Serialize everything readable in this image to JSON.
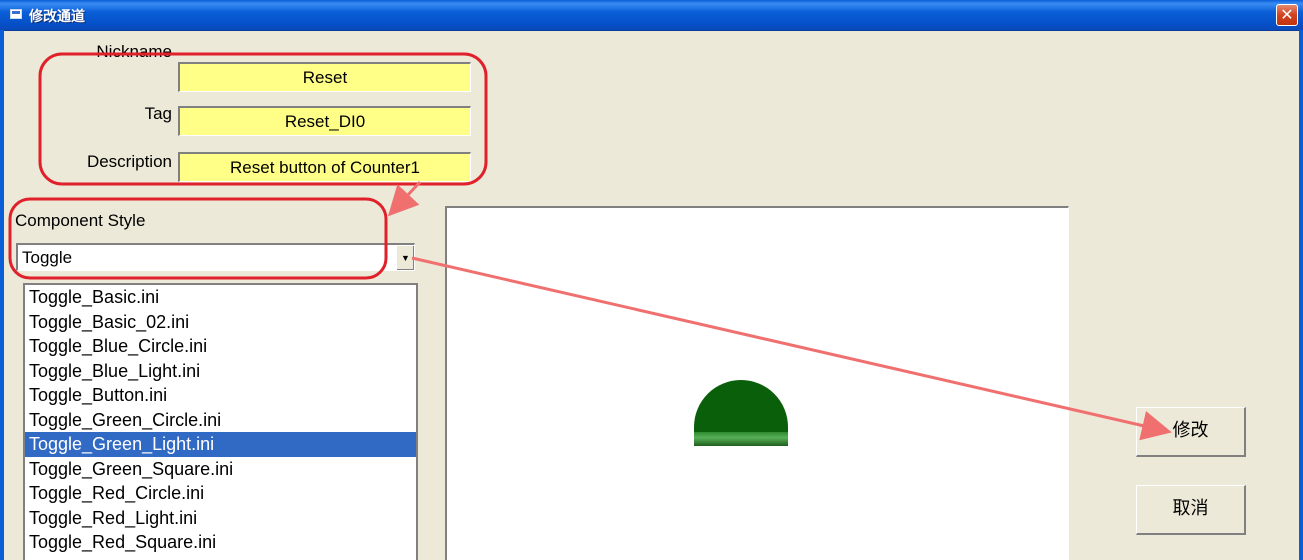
{
  "window": {
    "title": "修改通道",
    "close_icon": "close-icon"
  },
  "form": {
    "nickname_label": "Nickname",
    "nickname_value": "Reset",
    "tag_label": "Tag",
    "tag_value": "Reset_DI0",
    "description_label": "Description",
    "description_value": "Reset button of Counter1"
  },
  "component_style": {
    "label": "Component Style",
    "selected": "Toggle",
    "items": [
      "Toggle_Basic.ini",
      "Toggle_Basic_02.ini",
      "Toggle_Blue_Circle.ini",
      "Toggle_Blue_Light.ini",
      "Toggle_Button.ini",
      "Toggle_Green_Circle.ini",
      "Toggle_Green_Light.ini",
      "Toggle_Green_Square.ini",
      "Toggle_Red_Circle.ini",
      "Toggle_Red_Light.ini",
      "Toggle_Red_Square.ini"
    ],
    "selected_item": "Toggle_Green_Light.ini"
  },
  "buttons": {
    "modify": "修改",
    "cancel": "取消"
  },
  "colors": {
    "field_bg": "#ffff88",
    "selection": "#316ac5",
    "annotation": "#e0202a",
    "lamp": "#0a5f0a"
  }
}
